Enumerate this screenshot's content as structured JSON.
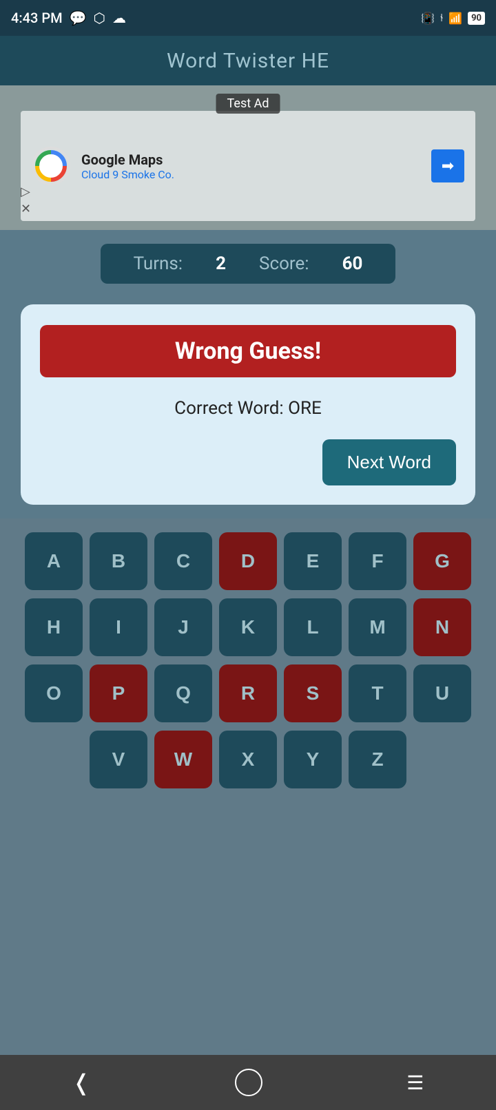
{
  "statusBar": {
    "time": "4:43 PM",
    "battery": "90"
  },
  "header": {
    "title": "Word Twister HE"
  },
  "ad": {
    "testLabel": "Test Ad",
    "company": "Google Maps",
    "subtitle": "Cloud 9 Smoke Co."
  },
  "score": {
    "turnsLabel": "Turns:",
    "turnsValue": "2",
    "scoreLabel": "Score:",
    "scoreValue": "60"
  },
  "dialog": {
    "wrongGuessText": "Wrong Guess!",
    "correctWordLabel": "Correct Word: ORE",
    "nextWordBtn": "Next Word"
  },
  "keyboard": {
    "rows": [
      [
        "A",
        "B",
        "C",
        "D",
        "E",
        "F",
        "G"
      ],
      [
        "H",
        "I",
        "J",
        "K",
        "L",
        "M",
        "N"
      ],
      [
        "O",
        "P",
        "Q",
        "R",
        "S",
        "T",
        "U"
      ],
      [
        "V",
        "W",
        "X",
        "Y",
        "Z"
      ]
    ],
    "usedKeys": [
      "D",
      "G",
      "N",
      "P",
      "R",
      "S",
      "W"
    ]
  },
  "bottomNav": {
    "back": "‹",
    "home": "○",
    "menu": "≡"
  }
}
